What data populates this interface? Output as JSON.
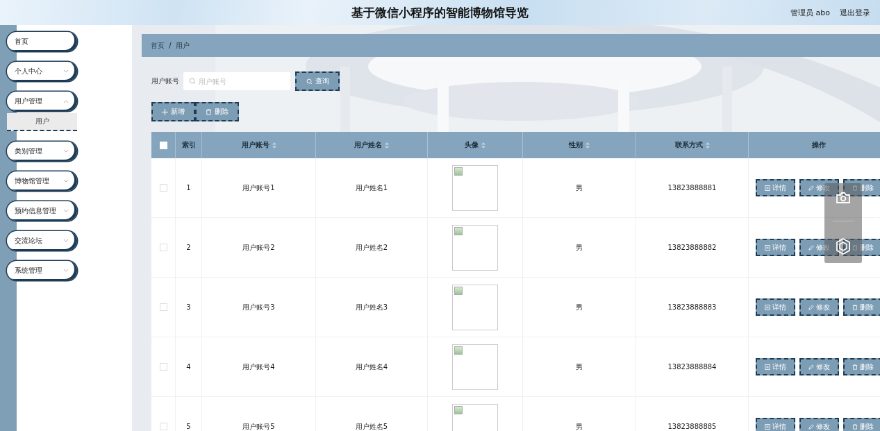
{
  "header": {
    "title": "基于微信小程序的智能博物馆导览",
    "user": "管理员 abo",
    "logout": "退出登录"
  },
  "sidebar": {
    "items": [
      {
        "label": "首页",
        "kind": "link"
      },
      {
        "label": "个人中心",
        "kind": "menu",
        "expanded": false
      },
      {
        "label": "用户管理",
        "kind": "menu",
        "expanded": true,
        "children": [
          {
            "label": "用户",
            "selected": true
          }
        ]
      },
      {
        "label": "类别管理",
        "kind": "menu",
        "expanded": false
      },
      {
        "label": "博物馆管理",
        "kind": "menu",
        "expanded": false
      },
      {
        "label": "预约信息管理",
        "kind": "menu",
        "expanded": false
      },
      {
        "label": "交流论坛",
        "kind": "menu",
        "expanded": false
      },
      {
        "label": "系统管理",
        "kind": "menu",
        "expanded": false
      }
    ]
  },
  "breadcrumb": {
    "items": [
      "首页",
      "用户"
    ],
    "separator": "/"
  },
  "search": {
    "label": "用户账号",
    "placeholder": "用户账号",
    "button": "查询"
  },
  "actions": [
    {
      "label": "新增",
      "kind": "add"
    },
    {
      "label": "删除",
      "kind": "delete"
    }
  ],
  "table": {
    "select_all": {
      "checked": false
    },
    "columns": [
      {
        "label": "索引",
        "sortable": false
      },
      {
        "label": "用户账号",
        "sortable": true
      },
      {
        "label": "用户姓名",
        "sortable": true
      },
      {
        "label": "头像",
        "sortable": true
      },
      {
        "label": "性别",
        "sortable": true
      },
      {
        "label": "联系方式",
        "sortable": true
      },
      {
        "label": "操作",
        "sortable": false
      }
    ],
    "rows": [
      {
        "checked": false,
        "index": "1",
        "account": "用户账号1",
        "name": "用户姓名1",
        "gender": "男",
        "phone": "13823888881",
        "actions": [
          {
            "label": "详情",
            "kind": "detail"
          },
          {
            "label": "修改",
            "kind": "edit"
          },
          {
            "label": "删除",
            "kind": "delete"
          }
        ]
      },
      {
        "checked": false,
        "index": "2",
        "account": "用户账号2",
        "name": "用户姓名2",
        "gender": "男",
        "phone": "13823888882",
        "actions": [
          {
            "label": "详情",
            "kind": "detail"
          },
          {
            "label": "修改",
            "kind": "edit"
          },
          {
            "label": "删除",
            "kind": "delete"
          }
        ]
      },
      {
        "checked": false,
        "index": "3",
        "account": "用户账号3",
        "name": "用户姓名3",
        "gender": "男",
        "phone": "13823888883",
        "actions": [
          {
            "label": "详情",
            "kind": "detail"
          },
          {
            "label": "修改",
            "kind": "edit"
          },
          {
            "label": "删除",
            "kind": "delete"
          }
        ]
      },
      {
        "checked": false,
        "index": "4",
        "account": "用户账号4",
        "name": "用户姓名4",
        "gender": "男",
        "phone": "13823888884",
        "actions": [
          {
            "label": "详情",
            "kind": "detail"
          },
          {
            "label": "修改",
            "kind": "edit"
          },
          {
            "label": "删除",
            "kind": "delete"
          }
        ]
      },
      {
        "checked": false,
        "index": "5",
        "account": "用户账号5",
        "name": "用户姓名5",
        "gender": "男",
        "phone": "13823888885",
        "actions": [
          {
            "label": "详情",
            "kind": "detail"
          },
          {
            "label": "修改",
            "kind": "edit"
          },
          {
            "label": "删除",
            "kind": "delete"
          }
        ]
      }
    ]
  }
}
